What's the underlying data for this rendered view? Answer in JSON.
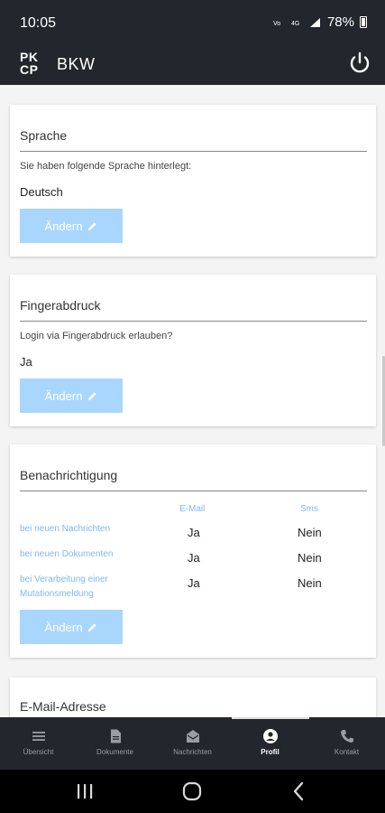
{
  "status_bar": {
    "time": "10:05",
    "battery": "78%"
  },
  "app_bar": {
    "logo_line1": "PK",
    "logo_line2": "CP",
    "title": "BKW"
  },
  "sprache": {
    "title": "Sprache",
    "label": "Sie haben folgende Sprache hinterlegt:",
    "value": "Deutsch",
    "button": "Ändern"
  },
  "finger": {
    "title": "Fingerabdruck",
    "label": "Login via Fingerabdruck erlauben?",
    "value": "Ja",
    "button": "Ändern"
  },
  "notif": {
    "title": "Benachrichtigung",
    "col_email": "E-Mail",
    "col_sms": "Sms",
    "rows": [
      {
        "label": "bei neuen Nachrichten",
        "email": "Ja",
        "sms": "Nein"
      },
      {
        "label": "bei neuen Dokumenten",
        "email": "Ja",
        "sms": "Nein"
      },
      {
        "label": "bei Verarbeitung einer Mutationsmeldung",
        "email": "Ja",
        "sms": "Nein"
      }
    ],
    "button": "Ändern"
  },
  "email_card": {
    "title": "E-Mail-Adresse"
  },
  "bottom_nav": {
    "items": [
      {
        "label": "Übersicht",
        "icon": "menu-icon"
      },
      {
        "label": "Dokumente",
        "icon": "document-icon"
      },
      {
        "label": "Nachrichten",
        "icon": "mail-open-icon"
      },
      {
        "label": "Profil",
        "icon": "user-circle-icon"
      },
      {
        "label": "Kontakt",
        "icon": "phone-icon"
      }
    ],
    "active": "Profil"
  },
  "colors": {
    "app_bar": "#23262c",
    "button": "#a9d6fc",
    "link_text": "#7fb8ef"
  }
}
